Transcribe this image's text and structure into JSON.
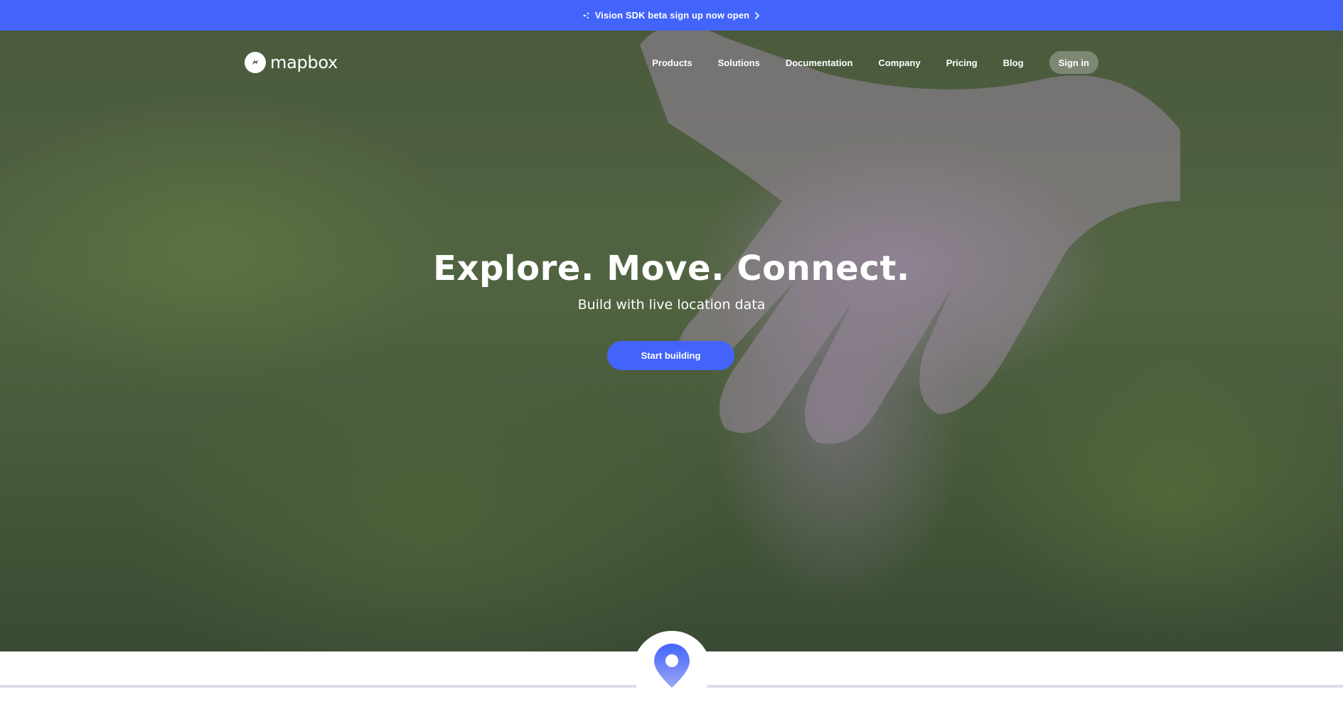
{
  "banner": {
    "text": "Vision SDK beta sign up now open",
    "sparkle_icon": "sparkle-icon",
    "chevron_icon": "chevron-right-icon"
  },
  "header": {
    "logo_text": "mapbox",
    "logo_icon": "mapbox-logo-icon",
    "nav": {
      "products": "Products",
      "solutions": "Solutions",
      "documentation": "Documentation",
      "company": "Company",
      "pricing": "Pricing",
      "blog": "Blog"
    },
    "signin_label": "Sign in"
  },
  "hero": {
    "headline": "Explore. Move. Connect.",
    "subheadline": "Build with live location data",
    "cta_label": "Start building",
    "background_description_icon": "moss-hand-photo"
  },
  "footer_teaser": {
    "pin_icon": "location-pin-icon"
  },
  "colors": {
    "brand_blue": "#4264fb",
    "white": "#ffffff"
  }
}
